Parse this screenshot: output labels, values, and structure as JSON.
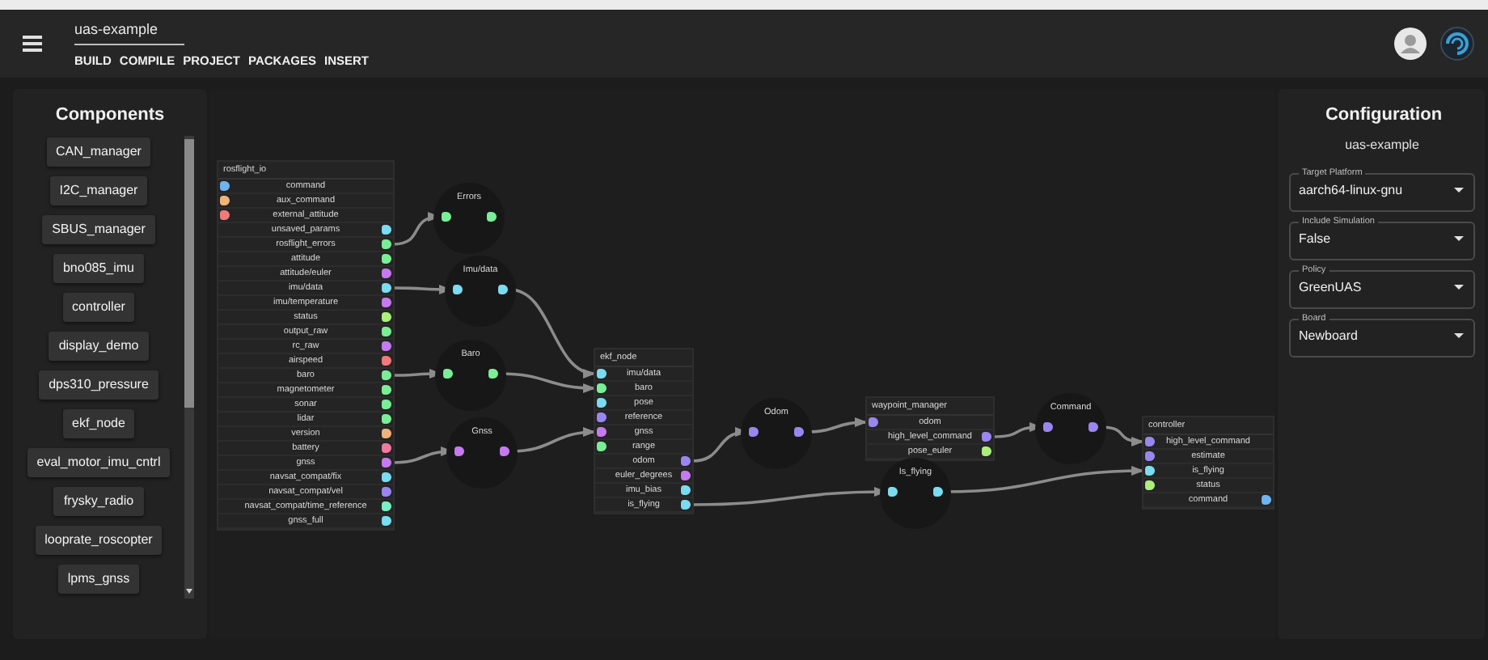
{
  "app_bar": {
    "title": "uas-example",
    "menu": [
      "BUILD",
      "COMPILE",
      "PROJECT",
      "PACKAGES",
      "INSERT"
    ]
  },
  "components": {
    "title": "Components",
    "items": [
      "CAN_manager",
      "I2C_manager",
      "SBUS_manager",
      "bno085_imu",
      "controller",
      "display_demo",
      "dps310_pressure",
      "ekf_node",
      "eval_motor_imu_cntrl",
      "frysky_radio",
      "looprate_roscopter",
      "lpms_gnss"
    ]
  },
  "graph": {
    "nodes": [
      {
        "kind": "block",
        "title": "rosflight_io",
        "inputs": [
          {
            "label": "command",
            "color": "#6fb4f0"
          },
          {
            "label": "aux_command",
            "color": "#f0b47a"
          },
          {
            "label": "external_attitude",
            "color": "#f07a7a"
          }
        ],
        "outputs": [
          {
            "label": "unsaved_params",
            "color": "#7adcf0"
          },
          {
            "label": "rosflight_errors",
            "color": "#7aee96"
          },
          {
            "label": "attitude",
            "color": "#7aee96"
          },
          {
            "label": "attitude/euler",
            "color": "#c67af0"
          },
          {
            "label": "imu/data",
            "color": "#7adcf0"
          },
          {
            "label": "imu/temperature",
            "color": "#c67af0"
          },
          {
            "label": "status",
            "color": "#aaf07a"
          },
          {
            "label": "output_raw",
            "color": "#7aee96"
          },
          {
            "label": "rc_raw",
            "color": "#c67af0"
          },
          {
            "label": "airspeed",
            "color": "#f07a7a"
          },
          {
            "label": "baro",
            "color": "#7aee96"
          },
          {
            "label": "magnetometer",
            "color": "#7aee96"
          },
          {
            "label": "sonar",
            "color": "#7aee96"
          },
          {
            "label": "lidar",
            "color": "#7aee96"
          },
          {
            "label": "version",
            "color": "#f0b47a"
          },
          {
            "label": "battery",
            "color": "#f07a9e"
          },
          {
            "label": "gnss",
            "color": "#c67af0"
          },
          {
            "label": "navsat_compat/fix",
            "color": "#7adcf0"
          },
          {
            "label": "navsat_compat/vel",
            "color": "#9a86f0"
          },
          {
            "label": "navsat_compat/time_reference",
            "color": "#7af0c4"
          },
          {
            "label": "gnss_full",
            "color": "#7adcf0"
          }
        ]
      },
      {
        "kind": "topic",
        "title": "Errors",
        "inputs": [
          {
            "color": "#7aee96"
          }
        ],
        "outputs": [
          {
            "color": "#7aee96"
          }
        ]
      },
      {
        "kind": "topic",
        "title": "Imu/data",
        "inputs": [
          {
            "color": "#7adcf0"
          }
        ],
        "outputs": [
          {
            "color": "#7adcf0"
          }
        ]
      },
      {
        "kind": "topic",
        "title": "Baro",
        "inputs": [
          {
            "color": "#7aee96"
          }
        ],
        "outputs": [
          {
            "color": "#7aee96"
          }
        ]
      },
      {
        "kind": "topic",
        "title": "Gnss",
        "inputs": [
          {
            "color": "#c67af0"
          }
        ],
        "outputs": [
          {
            "color": "#c67af0"
          }
        ]
      },
      {
        "kind": "block",
        "title": "ekf_node",
        "inputs": [
          {
            "label": "imu/data",
            "color": "#7adcf0"
          },
          {
            "label": "baro",
            "color": "#7aee96"
          },
          {
            "label": "pose",
            "color": "#7adcf0"
          },
          {
            "label": "reference",
            "color": "#9a86f0"
          },
          {
            "label": "gnss",
            "color": "#c67af0"
          },
          {
            "label": "range",
            "color": "#7aee96"
          }
        ],
        "outputs": [
          {
            "label": "odom",
            "color": "#9a86f0"
          },
          {
            "label": "euler_degrees",
            "color": "#c67af0"
          },
          {
            "label": "imu_bias",
            "color": "#7adcf0"
          },
          {
            "label": "is_flying",
            "color": "#7adcf0"
          }
        ]
      },
      {
        "kind": "topic",
        "title": "Odom",
        "inputs": [
          {
            "color": "#9a86f0"
          }
        ],
        "outputs": [
          {
            "color": "#9a86f0"
          }
        ]
      },
      {
        "kind": "block",
        "title": "waypoint_manager",
        "inputs": [
          {
            "label": "odom",
            "color": "#9a86f0"
          }
        ],
        "outputs": [
          {
            "label": "high_level_command",
            "color": "#9a86f0"
          },
          {
            "label": "pose_euler",
            "color": "#aaf07a"
          }
        ]
      },
      {
        "kind": "topic",
        "title": "Command",
        "inputs": [
          {
            "color": "#9a86f0"
          }
        ],
        "outputs": [
          {
            "color": "#9a86f0"
          }
        ]
      },
      {
        "kind": "topic",
        "title": "Is_flying",
        "inputs": [
          {
            "color": "#7adcf0"
          }
        ],
        "outputs": [
          {
            "color": "#7adcf0"
          }
        ]
      },
      {
        "kind": "block",
        "title": "controller",
        "inputs": [
          {
            "label": "high_level_command",
            "color": "#9a86f0"
          },
          {
            "label": "estimate",
            "color": "#9a86f0"
          },
          {
            "label": "is_flying",
            "color": "#7adcf0"
          },
          {
            "label": "status",
            "color": "#aaf07a"
          }
        ],
        "outputs": [
          {
            "label": "command",
            "color": "#6fb4f0"
          }
        ]
      }
    ]
  },
  "configuration": {
    "title": "Configuration",
    "project": "uas-example",
    "fields": [
      {
        "label": "Target Platform",
        "value": "aarch64-linux-gnu"
      },
      {
        "label": "Include Simulation",
        "value": "False"
      },
      {
        "label": "Policy",
        "value": "GreenUAS"
      },
      {
        "label": "Board",
        "value": "Newboard"
      }
    ]
  }
}
